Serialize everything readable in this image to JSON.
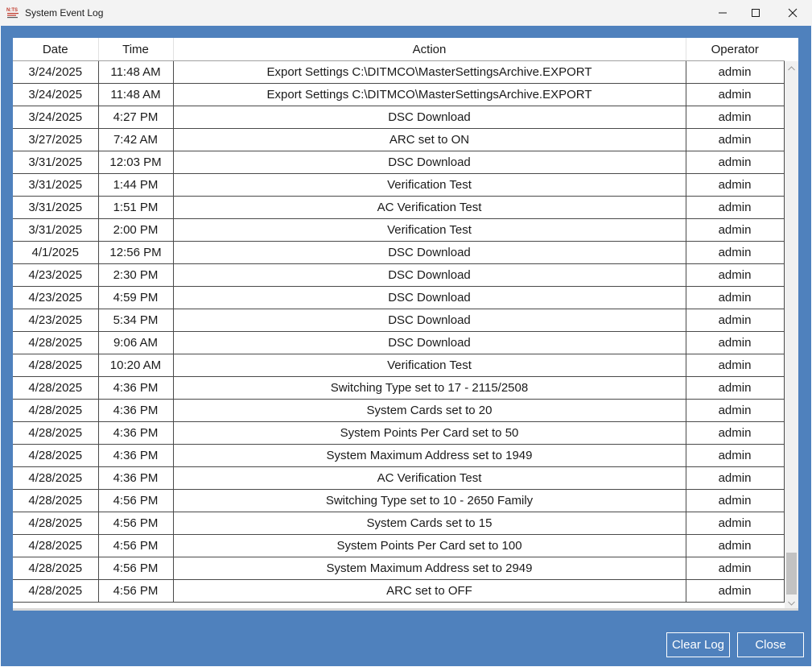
{
  "window": {
    "title": "System Event Log",
    "app_icon_text": "N:TS"
  },
  "table": {
    "columns": [
      "Date",
      "Time",
      "Action",
      "Operator"
    ],
    "rows": [
      [
        "3/24/2025",
        "11:48 AM",
        "Export Settings C:\\DITMCO\\MasterSettingsArchive.EXPORT",
        "admin"
      ],
      [
        "3/24/2025",
        "11:48 AM",
        "Export Settings C:\\DITMCO\\MasterSettingsArchive.EXPORT",
        "admin"
      ],
      [
        "3/24/2025",
        "4:27 PM",
        "DSC Download",
        "admin"
      ],
      [
        "3/27/2025",
        "7:42 AM",
        "ARC set to ON",
        "admin"
      ],
      [
        "3/31/2025",
        "12:03 PM",
        "DSC Download",
        "admin"
      ],
      [
        "3/31/2025",
        "1:44 PM",
        "Verification Test",
        "admin"
      ],
      [
        "3/31/2025",
        "1:51 PM",
        "AC Verification Test",
        "admin"
      ],
      [
        "3/31/2025",
        "2:00 PM",
        "Verification Test",
        "admin"
      ],
      [
        "4/1/2025",
        "12:56 PM",
        "DSC Download",
        "admin"
      ],
      [
        "4/23/2025",
        "2:30 PM",
        "DSC Download",
        "admin"
      ],
      [
        "4/23/2025",
        "4:59 PM",
        "DSC Download",
        "admin"
      ],
      [
        "4/23/2025",
        "5:34 PM",
        "DSC Download",
        "admin"
      ],
      [
        "4/28/2025",
        "9:06 AM",
        "DSC Download",
        "admin"
      ],
      [
        "4/28/2025",
        "10:20 AM",
        "Verification Test",
        "admin"
      ],
      [
        "4/28/2025",
        "4:36 PM",
        "Switching Type set to 17 - 2115/2508",
        "admin"
      ],
      [
        "4/28/2025",
        "4:36 PM",
        "System Cards set to 20",
        "admin"
      ],
      [
        "4/28/2025",
        "4:36 PM",
        "System Points Per Card set to 50",
        "admin"
      ],
      [
        "4/28/2025",
        "4:36 PM",
        "System Maximum Address set to 1949",
        "admin"
      ],
      [
        "4/28/2025",
        "4:36 PM",
        "AC Verification Test",
        "admin"
      ],
      [
        "4/28/2025",
        "4:56 PM",
        "Switching Type set to 10 - 2650 Family",
        "admin"
      ],
      [
        "4/28/2025",
        "4:56 PM",
        "System Cards set to 15",
        "admin"
      ],
      [
        "4/28/2025",
        "4:56 PM",
        "System Points Per Card set to 100",
        "admin"
      ],
      [
        "4/28/2025",
        "4:56 PM",
        "System Maximum Address set to 2949",
        "admin"
      ],
      [
        "4/28/2025",
        "4:56 PM",
        "ARC set to OFF",
        "admin"
      ]
    ]
  },
  "buttons": {
    "clear_log": "Clear Log",
    "close": "Close"
  },
  "colors": {
    "client_background": "#4f81bd",
    "title_bar": "#f3f3f3",
    "button_border": "#ffffff",
    "grid_line": "#4a4a4a"
  },
  "icons": {
    "minimize": "minimize-icon",
    "maximize": "maximize-icon",
    "close": "close-icon",
    "scroll_up": "chevron-up-icon",
    "scroll_down": "chevron-down-icon"
  }
}
